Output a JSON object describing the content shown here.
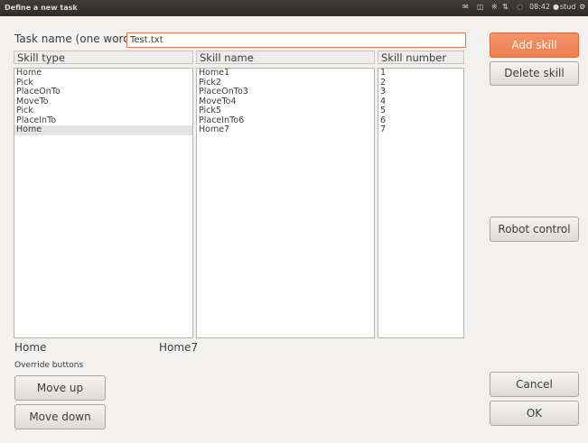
{
  "window": {
    "title": "Define a new task",
    "clock": "08:42",
    "user": "stud"
  },
  "task": {
    "name_label": "Task name (one word)",
    "name_value": "Test.txt"
  },
  "columns": {
    "skill_type": "Skill type",
    "skill_name": "Skill name",
    "skill_number": "Skill number"
  },
  "skill_types": [
    "Home",
    "Pick",
    "PlaceOnTo",
    "MoveTo",
    "Pick",
    "PlaceInTo",
    "Home"
  ],
  "skill_names": [
    "Home1",
    "Pick2",
    "PlaceOnTo3",
    "MoveTo4",
    "Pick5",
    "PlaceInTo6",
    "Home7"
  ],
  "skill_numbers": [
    "1",
    "2",
    "3",
    "4",
    "5",
    "6",
    "7"
  ],
  "selection": {
    "type": "Home",
    "name": "Home7"
  },
  "override": {
    "label": "Override buttons",
    "move_up": "Move up",
    "move_down": "Move down"
  },
  "buttons": {
    "add_skill": "Add skill",
    "delete_skill": "Delete skill",
    "robot_control": "Robot control",
    "cancel": "Cancel",
    "ok": "OK"
  },
  "colors": {
    "accent": "#ec7f50",
    "topbar": "#3c3b37"
  },
  "icons": [
    "mail-icon",
    "battery-icon",
    "bluetooth-icon",
    "network-icon",
    "volume-icon",
    "user-icon",
    "gear-icon"
  ]
}
